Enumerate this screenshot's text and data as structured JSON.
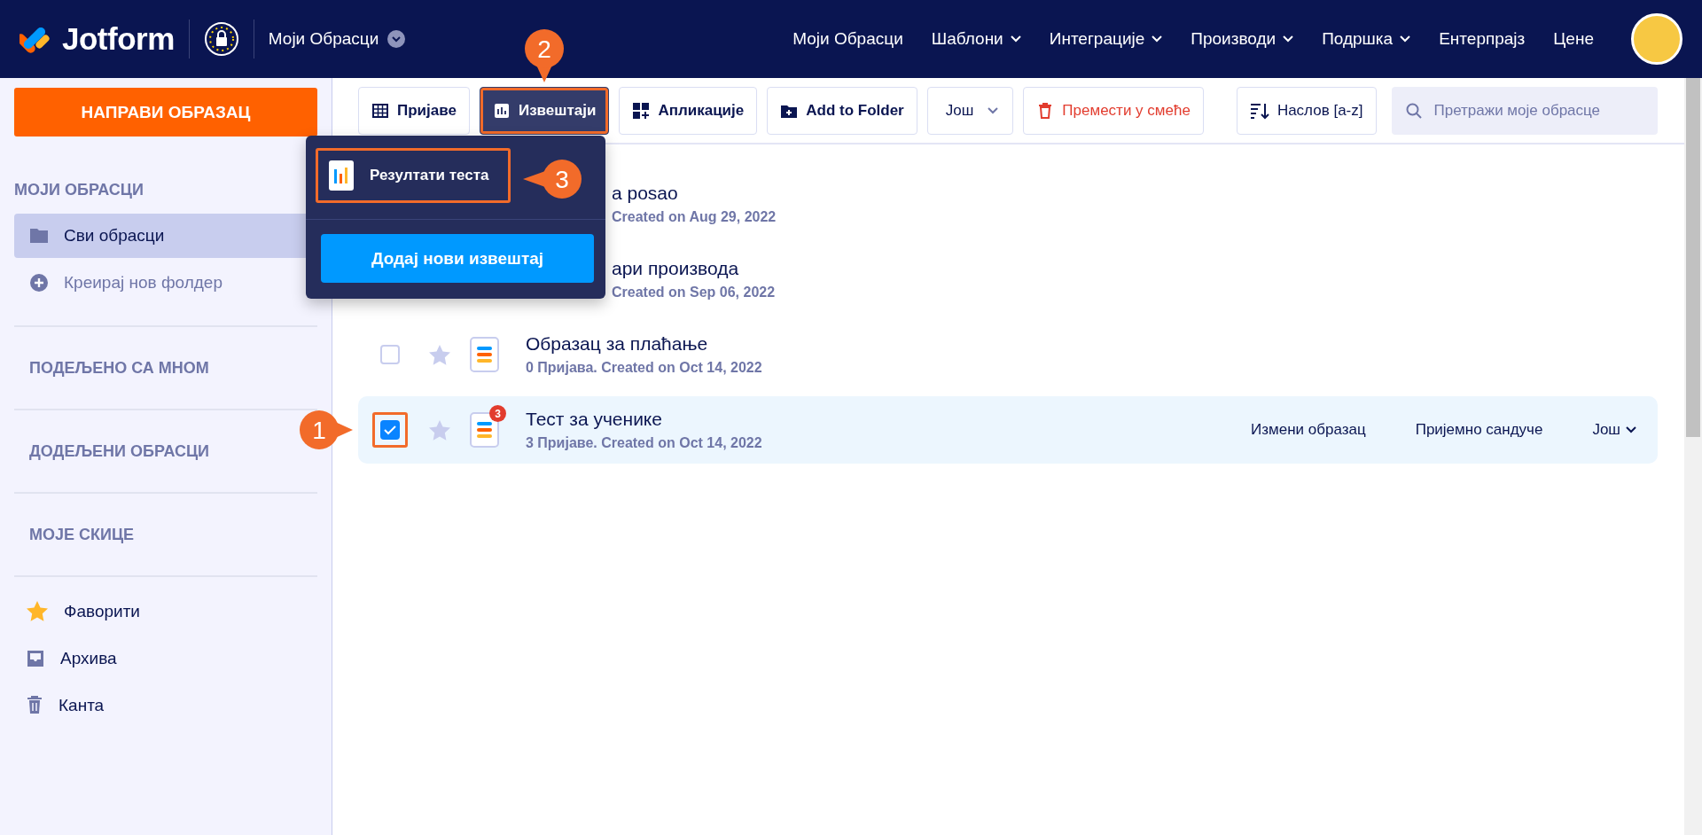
{
  "header": {
    "logo": "Jotform",
    "workspace": "Моји Обрасци",
    "nav": [
      {
        "label": "Моји Обрасци",
        "dropdown": false
      },
      {
        "label": "Шаблони",
        "dropdown": true
      },
      {
        "label": "Интеграције",
        "dropdown": true
      },
      {
        "label": "Производи",
        "dropdown": true
      },
      {
        "label": "Подршка",
        "dropdown": true
      },
      {
        "label": "Ентерпрајз",
        "dropdown": false
      },
      {
        "label": "Цене",
        "dropdown": false
      }
    ]
  },
  "sidebar": {
    "create_button": "НАПРАВИ ОБРАЗАЦ",
    "heading": "МОЈИ ОБРАСЦИ",
    "items": [
      {
        "label": "Сви обрасци",
        "selected": true
      },
      {
        "label": "Креирај нов фолдер",
        "selected": false
      }
    ],
    "sections": [
      "ПОДЕЉЕНО СА МНОМ",
      "ДОДЕЉЕНИ ОБРАСЦИ",
      "МОЈЕ СКИЦЕ"
    ],
    "bottom_items": [
      "Фаворити",
      "Архива",
      "Канта"
    ]
  },
  "toolbar": {
    "buttons": [
      {
        "label": "Пријаве",
        "kind": "normal",
        "outlined": false
      },
      {
        "label": "Извештаји",
        "kind": "active",
        "outlined": true
      },
      {
        "label": "Апликације",
        "kind": "normal",
        "outlined": false
      },
      {
        "label": "Add to Folder",
        "kind": "normal",
        "outlined": false
      },
      {
        "label": "Још",
        "kind": "more",
        "outlined": false
      },
      {
        "label": "Премести у смеће",
        "kind": "danger",
        "outlined": false
      }
    ],
    "sort": "Наслов [a-z]",
    "search": {
      "placeholder": "Претражи моје обрасце"
    }
  },
  "reports_menu": {
    "items": [
      {
        "label": "Резултати теста",
        "outlined": true
      }
    ],
    "add_button": "Додај нови извештај"
  },
  "forms": [
    {
      "kind": "partial",
      "title": "a posao",
      "subtitle": "Created on Aug 29, 2022"
    },
    {
      "kind": "partial",
      "title": "ари производа",
      "subtitle": "Created on Sep 06, 2022"
    },
    {
      "kind": "full",
      "title": "Образац за плаћање",
      "subtitle": "0 Пријава. Created on Oct 14, 2022",
      "checked": false,
      "outlined": false
    },
    {
      "kind": "full",
      "title": "Тест за ученике",
      "subtitle": "3 Пријаве. Created on Oct 14, 2022",
      "checked": true,
      "outlined": true,
      "badge": "3",
      "actions": [
        "Измени образац",
        "Пријемно сандуче",
        "Још"
      ]
    }
  ],
  "annotations": [
    "1",
    "2",
    "3"
  ]
}
